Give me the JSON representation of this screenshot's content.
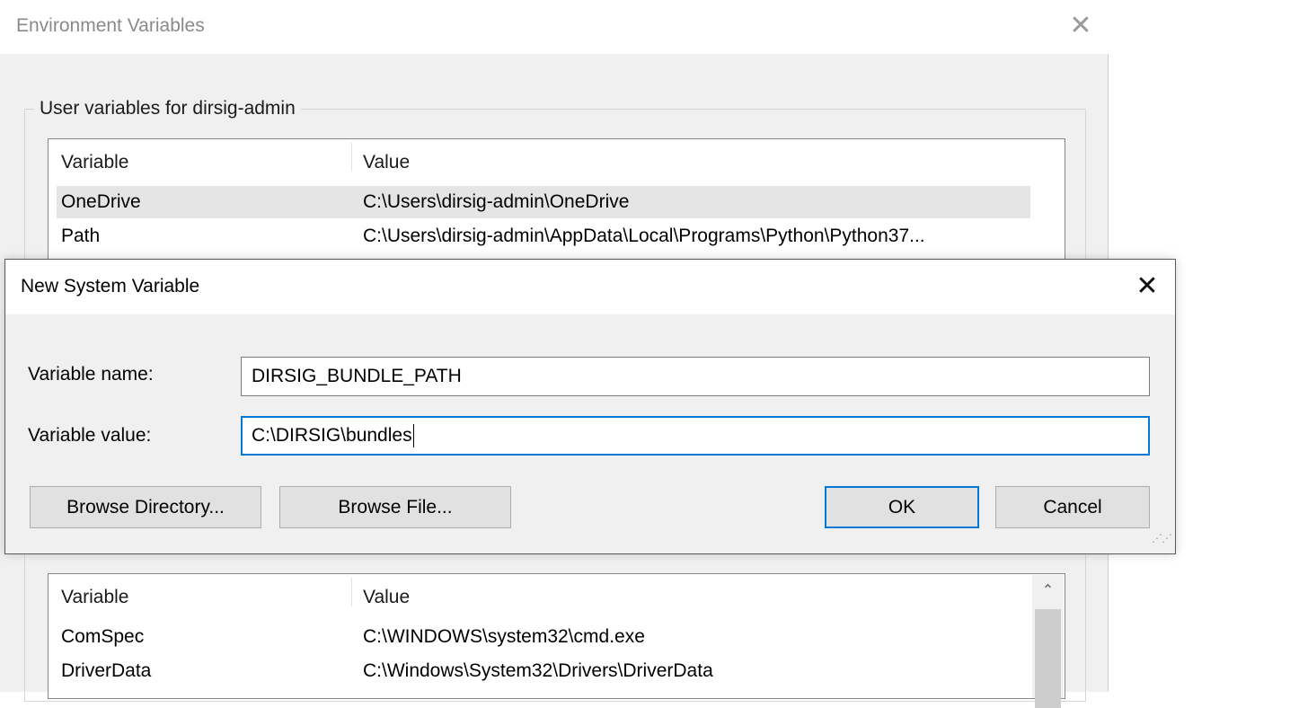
{
  "env_window": {
    "title": "Environment Variables",
    "close_glyph": "✕",
    "user_group_label": "User variables for dirsig-admin",
    "user_table": {
      "columns": [
        "Variable",
        "Value"
      ],
      "rows": [
        {
          "name": "OneDrive",
          "value": "C:\\Users\\dirsig-admin\\OneDrive",
          "selected": true
        },
        {
          "name": "Path",
          "value": "C:\\Users\\dirsig-admin\\AppData\\Local\\Programs\\Python\\Python37...",
          "selected": false
        }
      ]
    },
    "system_table": {
      "columns": [
        "Variable",
        "Value"
      ],
      "rows": [
        {
          "name": "ComSpec",
          "value": "C:\\WINDOWS\\system32\\cmd.exe"
        },
        {
          "name": "DriverData",
          "value": "C:\\Windows\\System32\\Drivers\\DriverData"
        }
      ],
      "scroll_up_glyph": "⌃"
    }
  },
  "dialog": {
    "title": "New System Variable",
    "close_glyph": "✕",
    "name_label": "Variable name:",
    "name_value": "DIRSIG_BUNDLE_PATH",
    "value_label": "Variable value:",
    "value_value": "C:\\DIRSIG\\bundles",
    "buttons": {
      "browse_directory": "Browse Directory...",
      "browse_file": "Browse File...",
      "ok": "OK",
      "cancel": "Cancel"
    },
    "accent_color": "#0078d7"
  }
}
